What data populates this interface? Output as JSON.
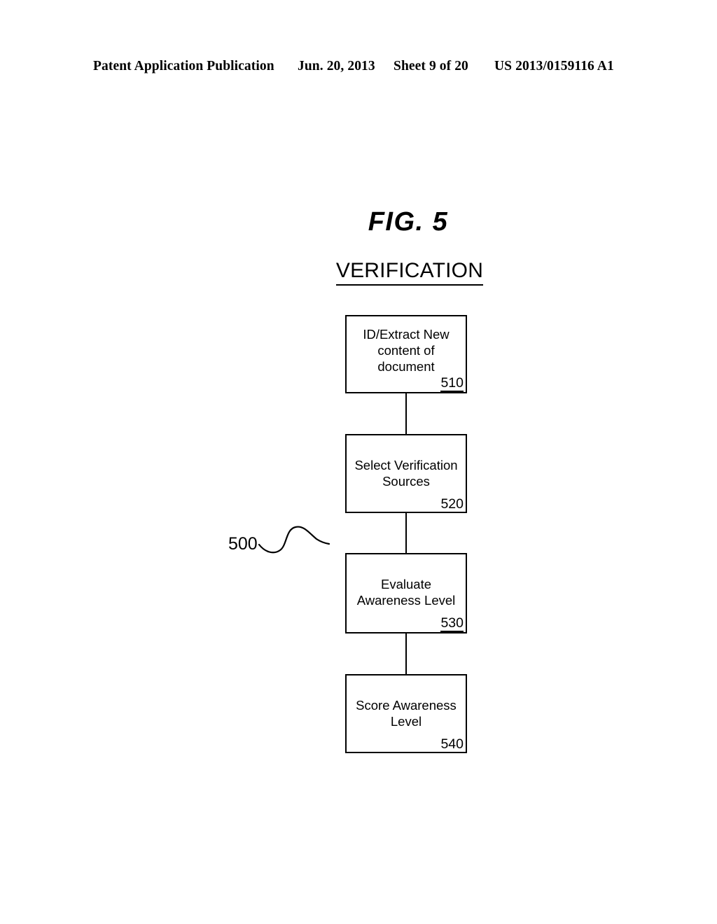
{
  "header": {
    "publication": "Patent Application Publication",
    "date": "Jun. 20, 2013",
    "sheet": "Sheet 9 of 20",
    "patent_number": "US 2013/0159116 A1"
  },
  "figure": {
    "label": "FIG. 5",
    "title": "VERIFICATION",
    "overall_ref": "500"
  },
  "flowchart": {
    "type": "flowchart",
    "orientation": "vertical",
    "connector_style": "plain-line",
    "steps": [
      {
        "text": "ID/Extract New\ncontent of\ndocument",
        "ref": "510"
      },
      {
        "text": "Select Verification\nSources",
        "ref": "520"
      },
      {
        "text": "Evaluate\nAwareness Level",
        "ref": "530"
      },
      {
        "text": "Score Awareness\nLevel",
        "ref": "540"
      }
    ]
  },
  "colors": {
    "ink": "#000000",
    "paper": "#ffffff"
  }
}
